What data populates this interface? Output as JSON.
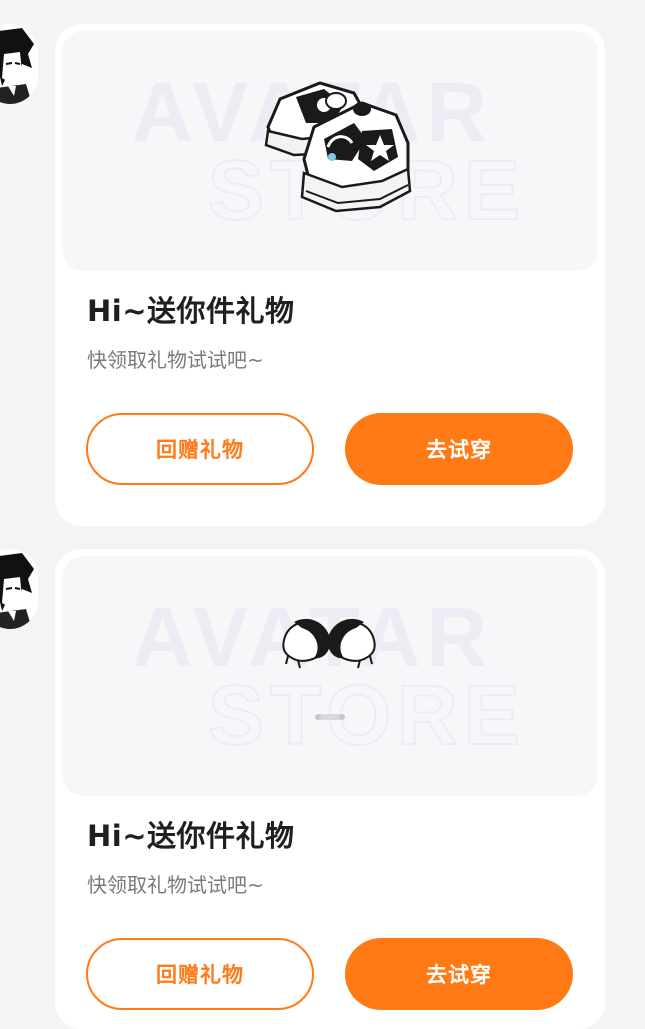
{
  "messages": [
    {
      "watermark_top": "AVATAR",
      "watermark_bottom": "STORE",
      "item_icon": "sneaker-icon",
      "title": "Hi~送你件礼物",
      "subtitle": "快领取礼物试试吧~",
      "return_gift_label": "回赠礼物",
      "try_on_label": "去试穿"
    },
    {
      "watermark_top": "AVATAR",
      "watermark_bottom": "STORE",
      "item_icon": "fluffy-hair-clips-icon",
      "title": "Hi~送你件礼物",
      "subtitle": "快领取礼物试试吧~",
      "return_gift_label": "回赠礼物",
      "try_on_label": "去试穿"
    }
  ],
  "colors": {
    "accent": "#ff7a14",
    "page_background": "#f4f4f6",
    "card_background": "#ffffff",
    "title_text": "#1f1f1f",
    "subtitle_text": "#7a7a7a"
  }
}
